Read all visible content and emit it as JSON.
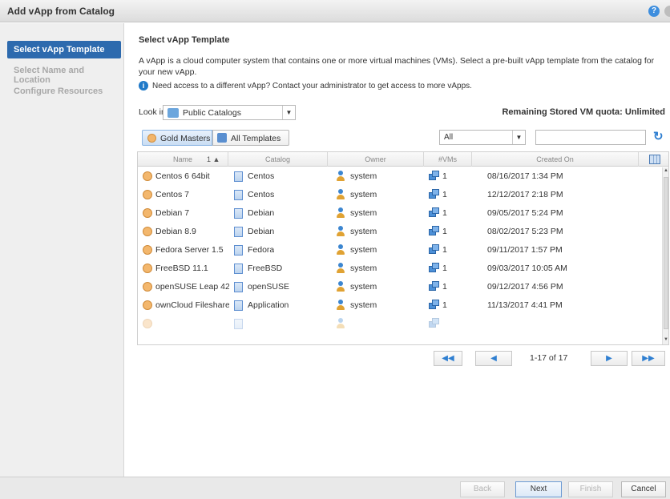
{
  "window": {
    "title": "Add vApp from Catalog"
  },
  "sidebar": {
    "steps": [
      {
        "label": "Select vApp Template"
      },
      {
        "label": "Select Name and Location"
      },
      {
        "label": "Configure Resources"
      }
    ]
  },
  "main": {
    "heading": "Select vApp Template",
    "description": "A vApp is a cloud computer system that contains one or more virtual machines (VMs). Select a pre-built vApp template from the catalog for your new vApp.",
    "info": "Need access to a different vApp? Contact your administrator to get access to more vApps.",
    "look_in_label": "Look in:",
    "look_in_value": "Public Catalogs",
    "quota": "Remaining Stored VM quota: Unlimited",
    "tabs": {
      "gold": "Gold Masters",
      "all": "All Templates"
    },
    "filter_value": "All",
    "search_value": ""
  },
  "table": {
    "columns": [
      "Name",
      "Catalog",
      "Owner",
      "#VMs",
      "Created On"
    ],
    "sort_indicator": "1 ▲",
    "rows": [
      {
        "name": "Centos 6 64bit",
        "catalog": "Centos",
        "owner": "system",
        "vms": "1",
        "created": "08/16/2017 1:34 PM"
      },
      {
        "name": "Centos 7",
        "catalog": "Centos",
        "owner": "system",
        "vms": "1",
        "created": "12/12/2017 2:18 PM"
      },
      {
        "name": "Debian 7",
        "catalog": "Debian",
        "owner": "system",
        "vms": "1",
        "created": "09/05/2017 5:24 PM"
      },
      {
        "name": "Debian 8.9",
        "catalog": "Debian",
        "owner": "system",
        "vms": "1",
        "created": "08/02/2017 5:23 PM"
      },
      {
        "name": "Fedora Server 1.5",
        "catalog": "Fedora",
        "owner": "system",
        "vms": "1",
        "created": "09/11/2017 1:57 PM"
      },
      {
        "name": "FreeBSD 11.1",
        "catalog": "FreeBSD",
        "owner": "system",
        "vms": "1",
        "created": "09/03/2017 10:05 AM"
      },
      {
        "name": "openSUSE Leap 42",
        "catalog": "openSUSE",
        "owner": "system",
        "vms": "1",
        "created": "09/12/2017 4:56 PM"
      },
      {
        "name": "ownCloud Fileshare",
        "catalog": "Application",
        "owner": "system",
        "vms": "1",
        "created": "11/13/2017 4:41 PM"
      }
    ]
  },
  "pager": {
    "info": "1-17 of 17",
    "first": "◀◀",
    "prev": "◀",
    "next": "▶",
    "last": "▶▶"
  },
  "footer": {
    "back": "Back",
    "next": "Next",
    "finish": "Finish",
    "cancel": "Cancel"
  },
  "colors": {
    "accent": "#2d6aae",
    "link": "#2f7fd1"
  }
}
